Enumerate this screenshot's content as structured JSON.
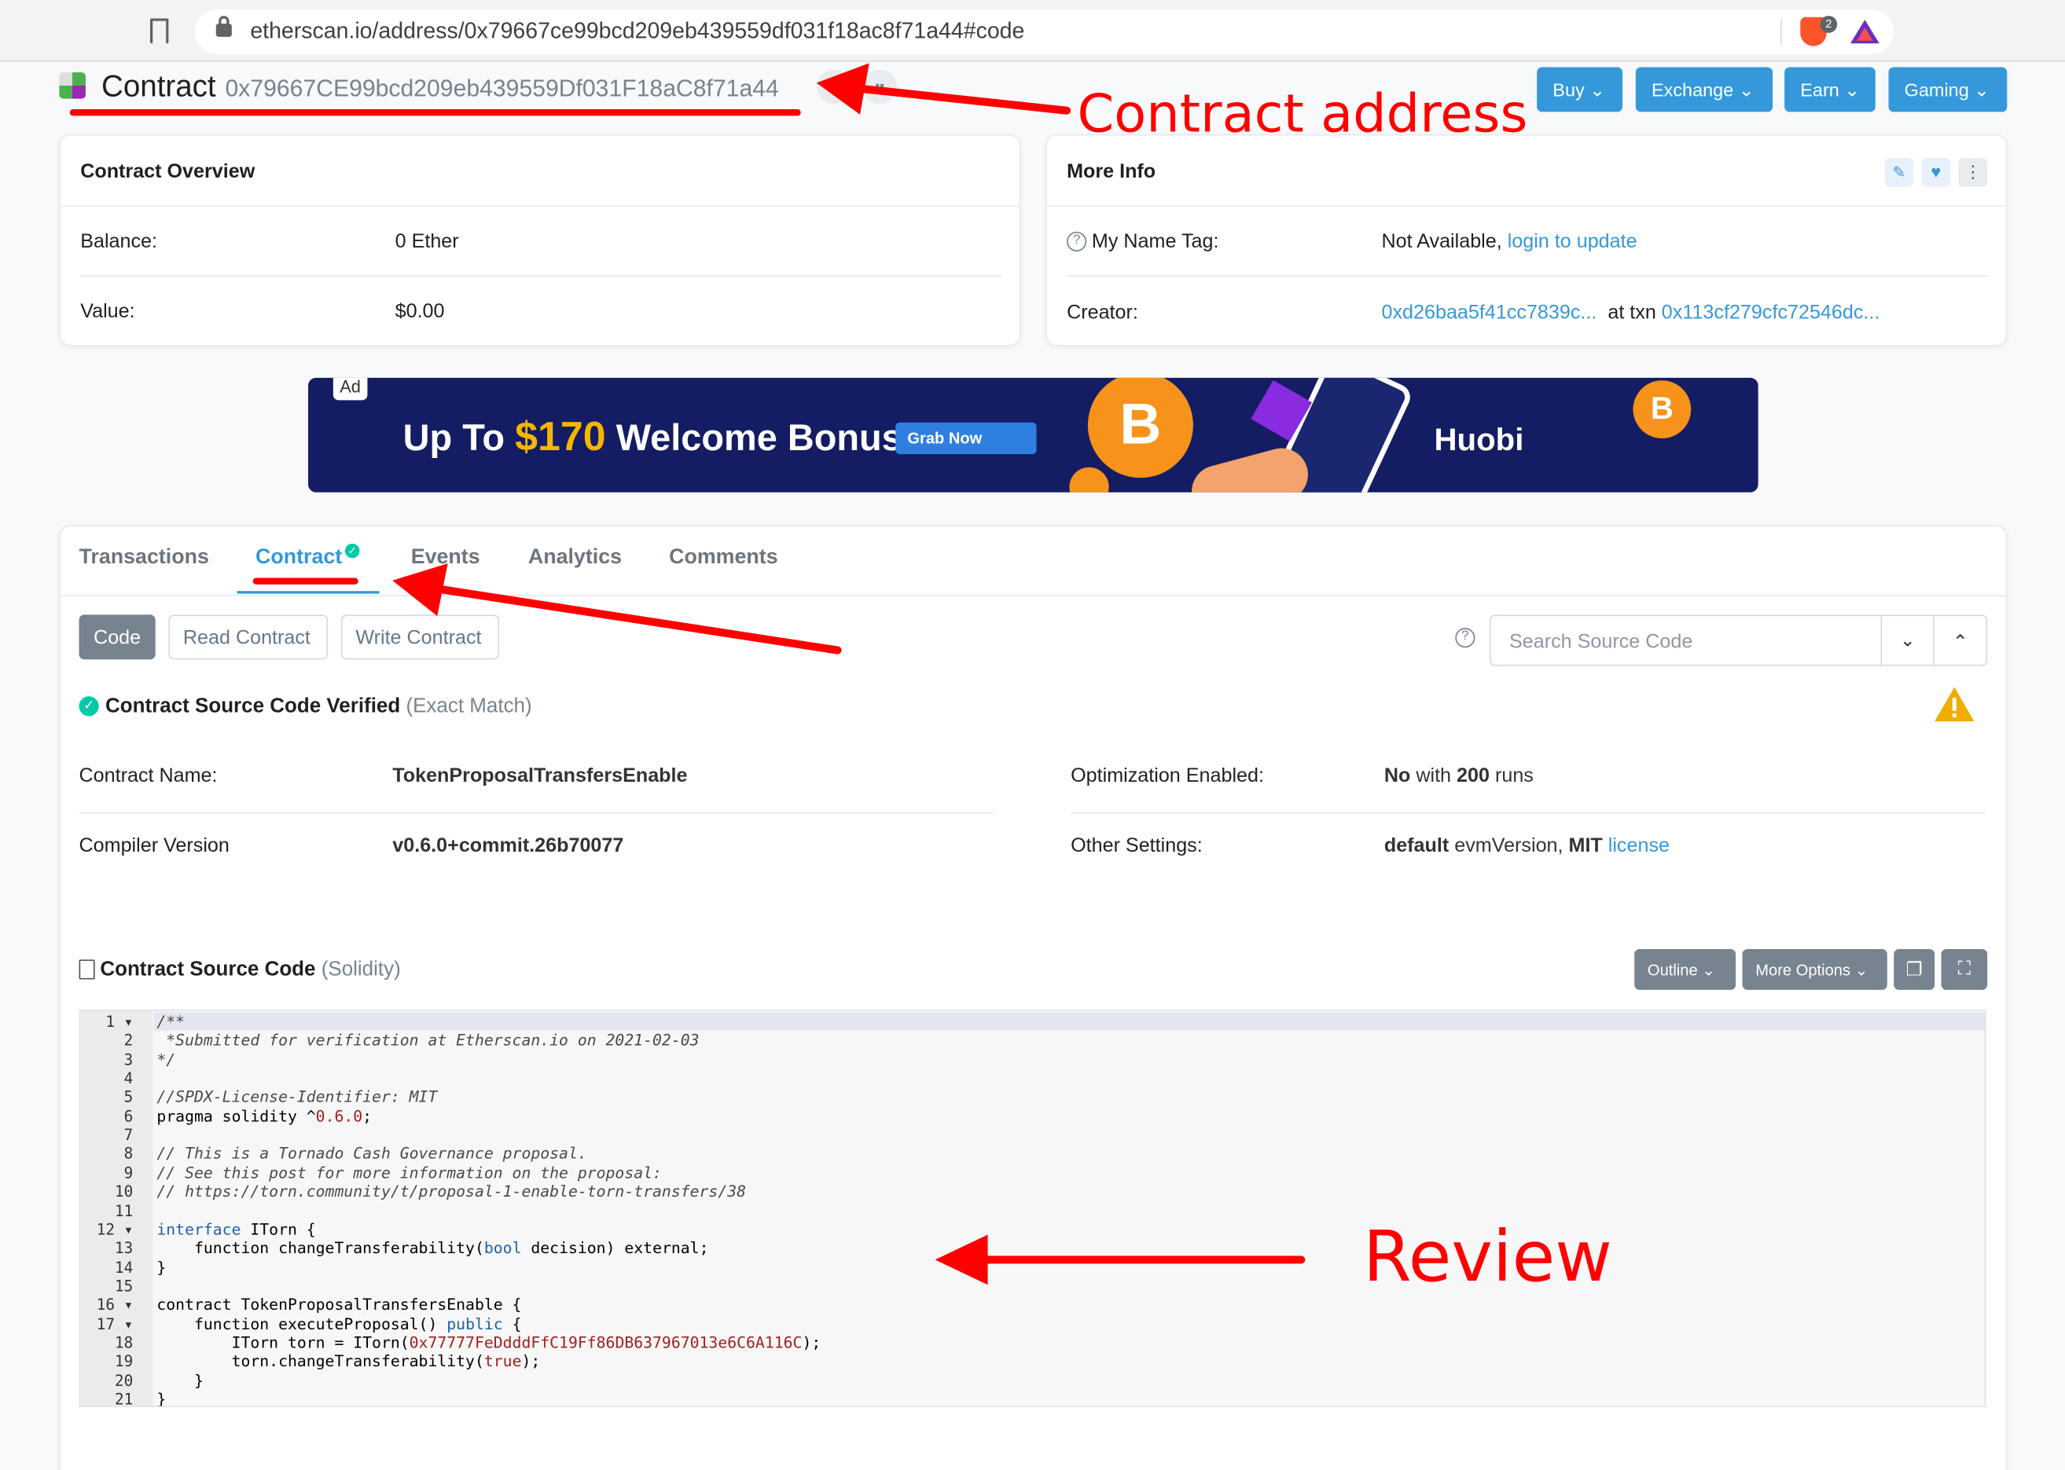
{
  "browser": {
    "url": "etherscan.io/address/0x79667ce99bcd209eb439559df031f18ac8f71a44#code",
    "extension_badge": "2"
  },
  "header": {
    "title": "Contract",
    "address": "0x79667CE99bcd209eb439559Df031F18aC8f71a44",
    "nav": [
      "Buy",
      "Exchange",
      "Earn",
      "Gaming"
    ]
  },
  "overview": {
    "title": "Contract Overview",
    "balance_label": "Balance:",
    "balance_value": "0 Ether",
    "value_label": "Value:",
    "value_value": "$0.00"
  },
  "more_info": {
    "title": "More Info",
    "name_tag_label": "My Name Tag:",
    "name_tag_value": "Not Available,",
    "name_tag_link": "login to update",
    "creator_label": "Creator:",
    "creator_address": "0xd26baa5f41cc7839c...",
    "creator_at": "at txn",
    "creator_txn": "0x113cf279cfc72546dc..."
  },
  "ad": {
    "tag": "Ad",
    "text_pre": "Up To",
    "amount": "$170",
    "text_post": "Welcome Bonus",
    "cta": "Grab Now",
    "brand": "Huobi"
  },
  "tabs": [
    "Transactions",
    "Contract",
    "Events",
    "Analytics",
    "Comments"
  ],
  "active_tab": "Contract",
  "subtabs": {
    "code": "Code",
    "read": "Read Contract",
    "write": "Write Contract"
  },
  "search": {
    "placeholder": "Search Source Code"
  },
  "verified": {
    "label": "Contract Source Code Verified",
    "match": "(Exact Match)"
  },
  "details": {
    "name_label": "Contract Name:",
    "name_value": "TokenProposalTransfersEnable",
    "compiler_label": "Compiler Version",
    "compiler_value": "v0.6.0+commit.26b70077",
    "opt_label": "Optimization Enabled:",
    "opt_no": "No",
    "opt_with": "with",
    "opt_runs": "200",
    "opt_runs_word": "runs",
    "other_label": "Other Settings:",
    "other_default": "default",
    "other_evm": "evmVersion,",
    "other_mit": "MIT",
    "other_license": "license"
  },
  "source": {
    "title": "Contract Source Code",
    "lang": "(Solidity)",
    "outline": "Outline",
    "more": "More Options"
  },
  "code_lines": [
    "/**",
    " *Submitted for verification at Etherscan.io on 2021-02-03",
    "*/",
    "",
    "//SPDX-License-Identifier: MIT",
    "pragma solidity ^0.6.0;",
    "",
    "// This is a Tornado Cash Governance proposal.",
    "// See this post for more information on the proposal:",
    "// https://torn.community/t/proposal-1-enable-torn-transfers/38",
    "",
    "interface ITorn {",
    "    function changeTransferability(bool decision) external;",
    "}",
    "",
    "contract TokenProposalTransfersEnable {",
    "    function executeProposal() public {",
    "        ITorn torn = ITorn(0x77777FeDdddFfC19Ff86DB637967013e6C6A116C);",
    "        torn.changeTransferability(true);",
    "    }",
    "}"
  ],
  "annotations": {
    "address": "Contract address",
    "review": "Review"
  },
  "colors": {
    "accent": "#3498db",
    "success": "#00c9a7",
    "warning": "#f0ad00",
    "annotation": "#ff0000",
    "ad_bg": "#141d63"
  }
}
